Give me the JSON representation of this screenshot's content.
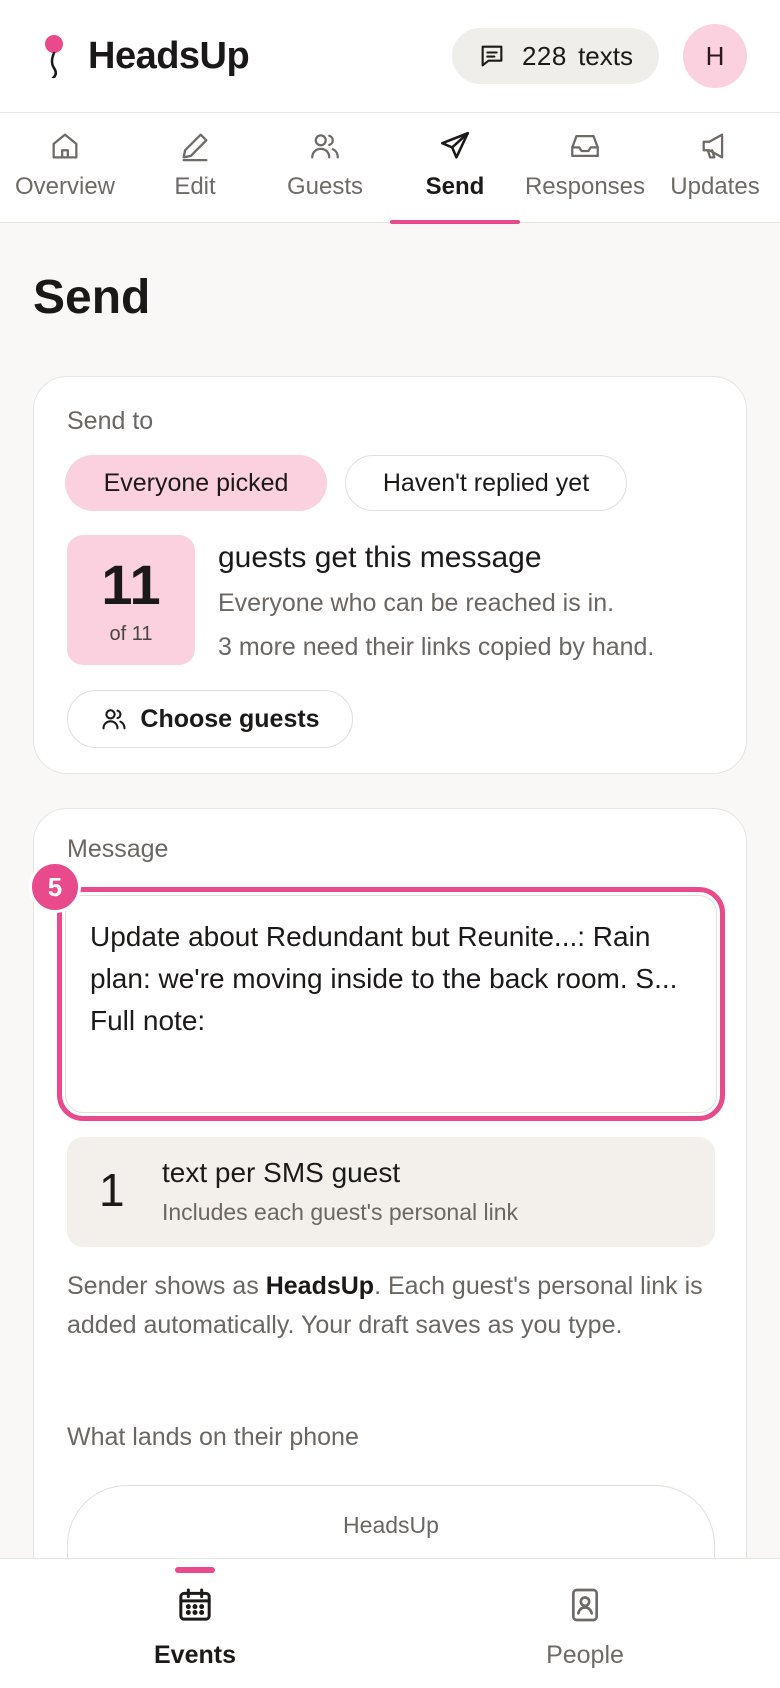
{
  "app": {
    "name": "HeadsUp",
    "accent_color": "#e84a8c",
    "selected_color": "#fbd1df"
  },
  "header": {
    "texts_count": "228",
    "texts_unit": "texts",
    "avatar_initial": "H"
  },
  "tabs": [
    {
      "label": "Overview",
      "icon": "home-icon"
    },
    {
      "label": "Edit",
      "icon": "pencil-icon"
    },
    {
      "label": "Guests",
      "icon": "users-icon"
    },
    {
      "label": "Send",
      "icon": "send-icon",
      "active": true
    },
    {
      "label": "Responses",
      "icon": "inbox-icon"
    },
    {
      "label": "Updates",
      "icon": "megaphone-icon"
    }
  ],
  "page": {
    "title": "Send"
  },
  "send_to": {
    "label": "Send to",
    "options": [
      "Everyone picked",
      "Haven't replied yet"
    ],
    "selected": "Everyone picked",
    "count": "11",
    "count_of": "of 11",
    "headline": "guests get this message",
    "line1": "Everyone who can be reached is in.",
    "line2": "3 more need their links copied by hand.",
    "choose_button": "Choose guests"
  },
  "message": {
    "label": "Message",
    "step_number": "5",
    "text": "Update about Redundant but Reunite...: Rain plan: we're moving inside to the back room. S... Full note:",
    "sms_count": "1",
    "sms_title": "text per SMS guest",
    "sms_subtitle": "Includes each guest's personal link",
    "note_prefix": "Sender shows as ",
    "note_sender": "HeadsUp",
    "note_suffix": ". Each guest's personal link is added automatically. Your draft saves as you type.",
    "preview_label": "What lands on their phone",
    "preview_sender": "HeadsUp"
  },
  "bottom_nav": [
    {
      "label": "Events",
      "icon": "calendar-icon",
      "active": true
    },
    {
      "label": "People",
      "icon": "contact-book-icon"
    }
  ]
}
